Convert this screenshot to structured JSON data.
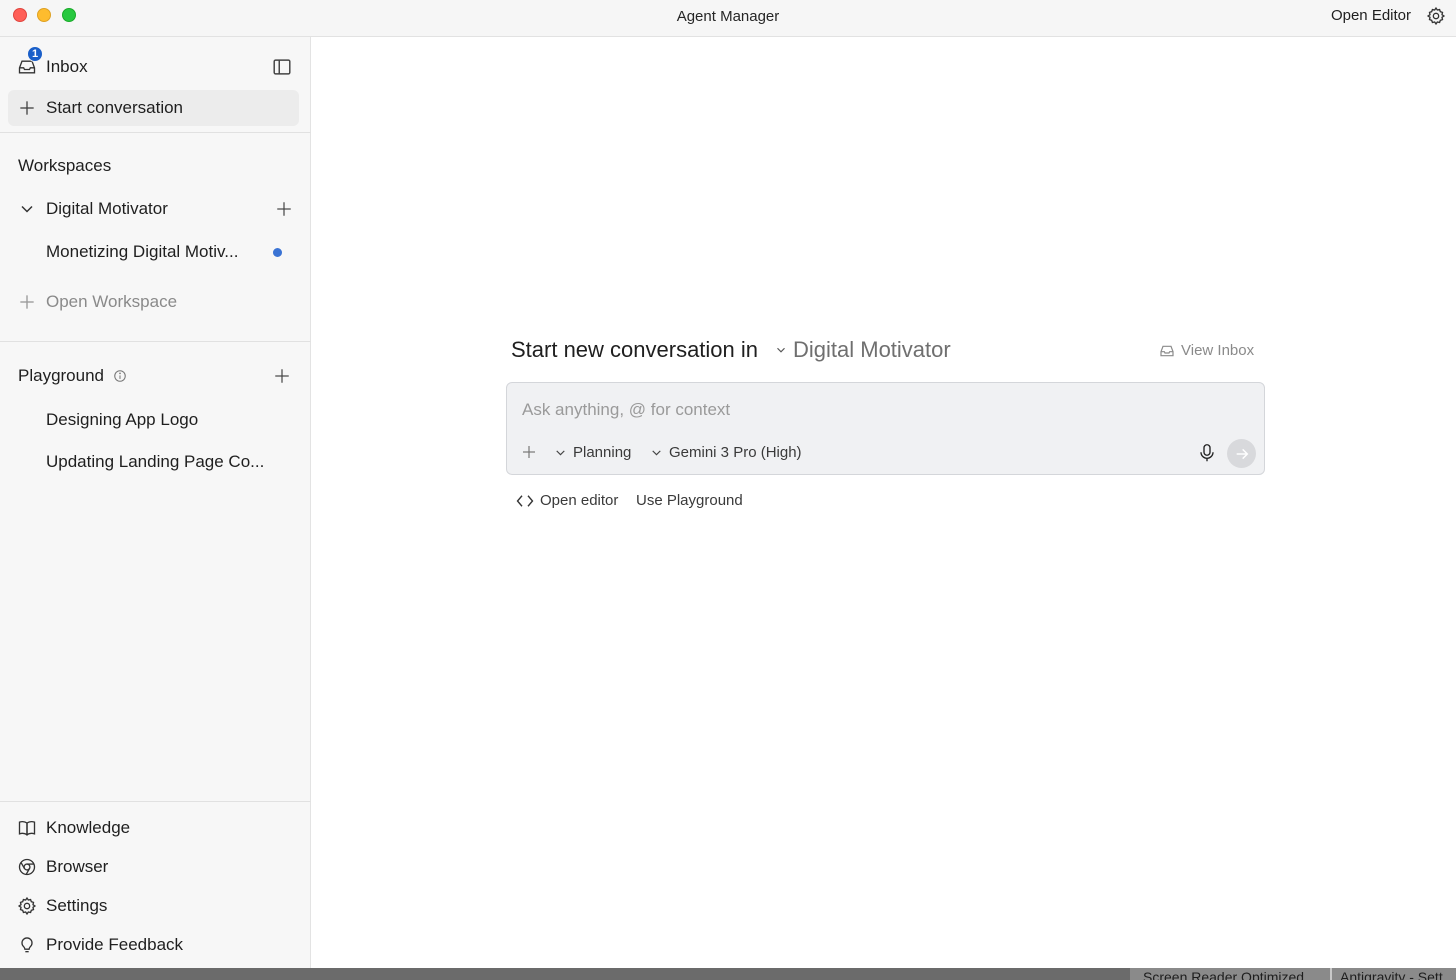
{
  "window": {
    "title": "Agent Manager",
    "open_editor": "Open Editor"
  },
  "sidebar": {
    "inbox": {
      "label": "Inbox",
      "badge": "1"
    },
    "start_conversation": "Start conversation",
    "workspaces": {
      "title": "Workspaces",
      "items": [
        {
          "label": "Digital Motivator",
          "expanded": true,
          "conversations": [
            {
              "label": "Monetizing Digital Motiv...",
              "unread": true
            }
          ]
        }
      ],
      "open_workspace": "Open Workspace"
    },
    "playground": {
      "title": "Playground",
      "items": [
        {
          "label": "Designing App Logo"
        },
        {
          "label": "Updating Landing Page Co..."
        }
      ]
    },
    "footer": [
      {
        "label": "Knowledge",
        "icon": "book-icon"
      },
      {
        "label": "Browser",
        "icon": "chrome-icon"
      },
      {
        "label": "Settings",
        "icon": "gear-icon"
      },
      {
        "label": "Provide Feedback",
        "icon": "lightbulb-icon"
      }
    ]
  },
  "main": {
    "heading": "Start new conversation in",
    "workspace": "Digital Motivator",
    "view_inbox": "View Inbox",
    "composer": {
      "placeholder": "Ask anything, @ for context",
      "mode": "Planning",
      "model": "Gemini 3 Pro (High)"
    },
    "links": {
      "open_editor": "Open editor",
      "use_playground": "Use Playground"
    }
  },
  "taskbar": {
    "item1": "Screen Reader Optimized",
    "item2": "Antigravity - Sett"
  },
  "colors": {
    "accent": "#1a5fc9",
    "unread_dot": "#3a73d4",
    "sidebar_bg": "#f7f7f7"
  }
}
